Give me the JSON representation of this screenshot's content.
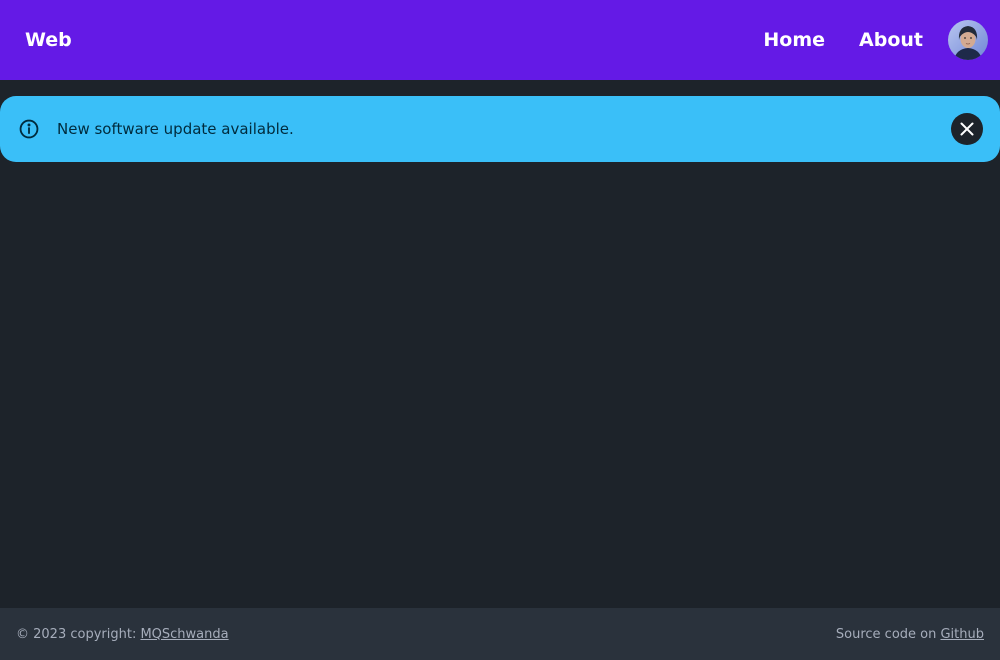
{
  "navbar": {
    "brand": "Web",
    "links": [
      "Home",
      "About"
    ],
    "avatar_icon": "user-avatar",
    "background": "#641ae6"
  },
  "alert": {
    "message": "New software update available.",
    "info_icon": "info-icon",
    "close_icon": "close-icon",
    "background": "#3abff8"
  },
  "footer": {
    "copyright_prefix": "© 2023 copyright: ",
    "author": "MQSchwanda",
    "source_prefix": "Source code on ",
    "source_link": "Github",
    "background": "#2a323c"
  },
  "page": {
    "background": "#1d232a"
  }
}
